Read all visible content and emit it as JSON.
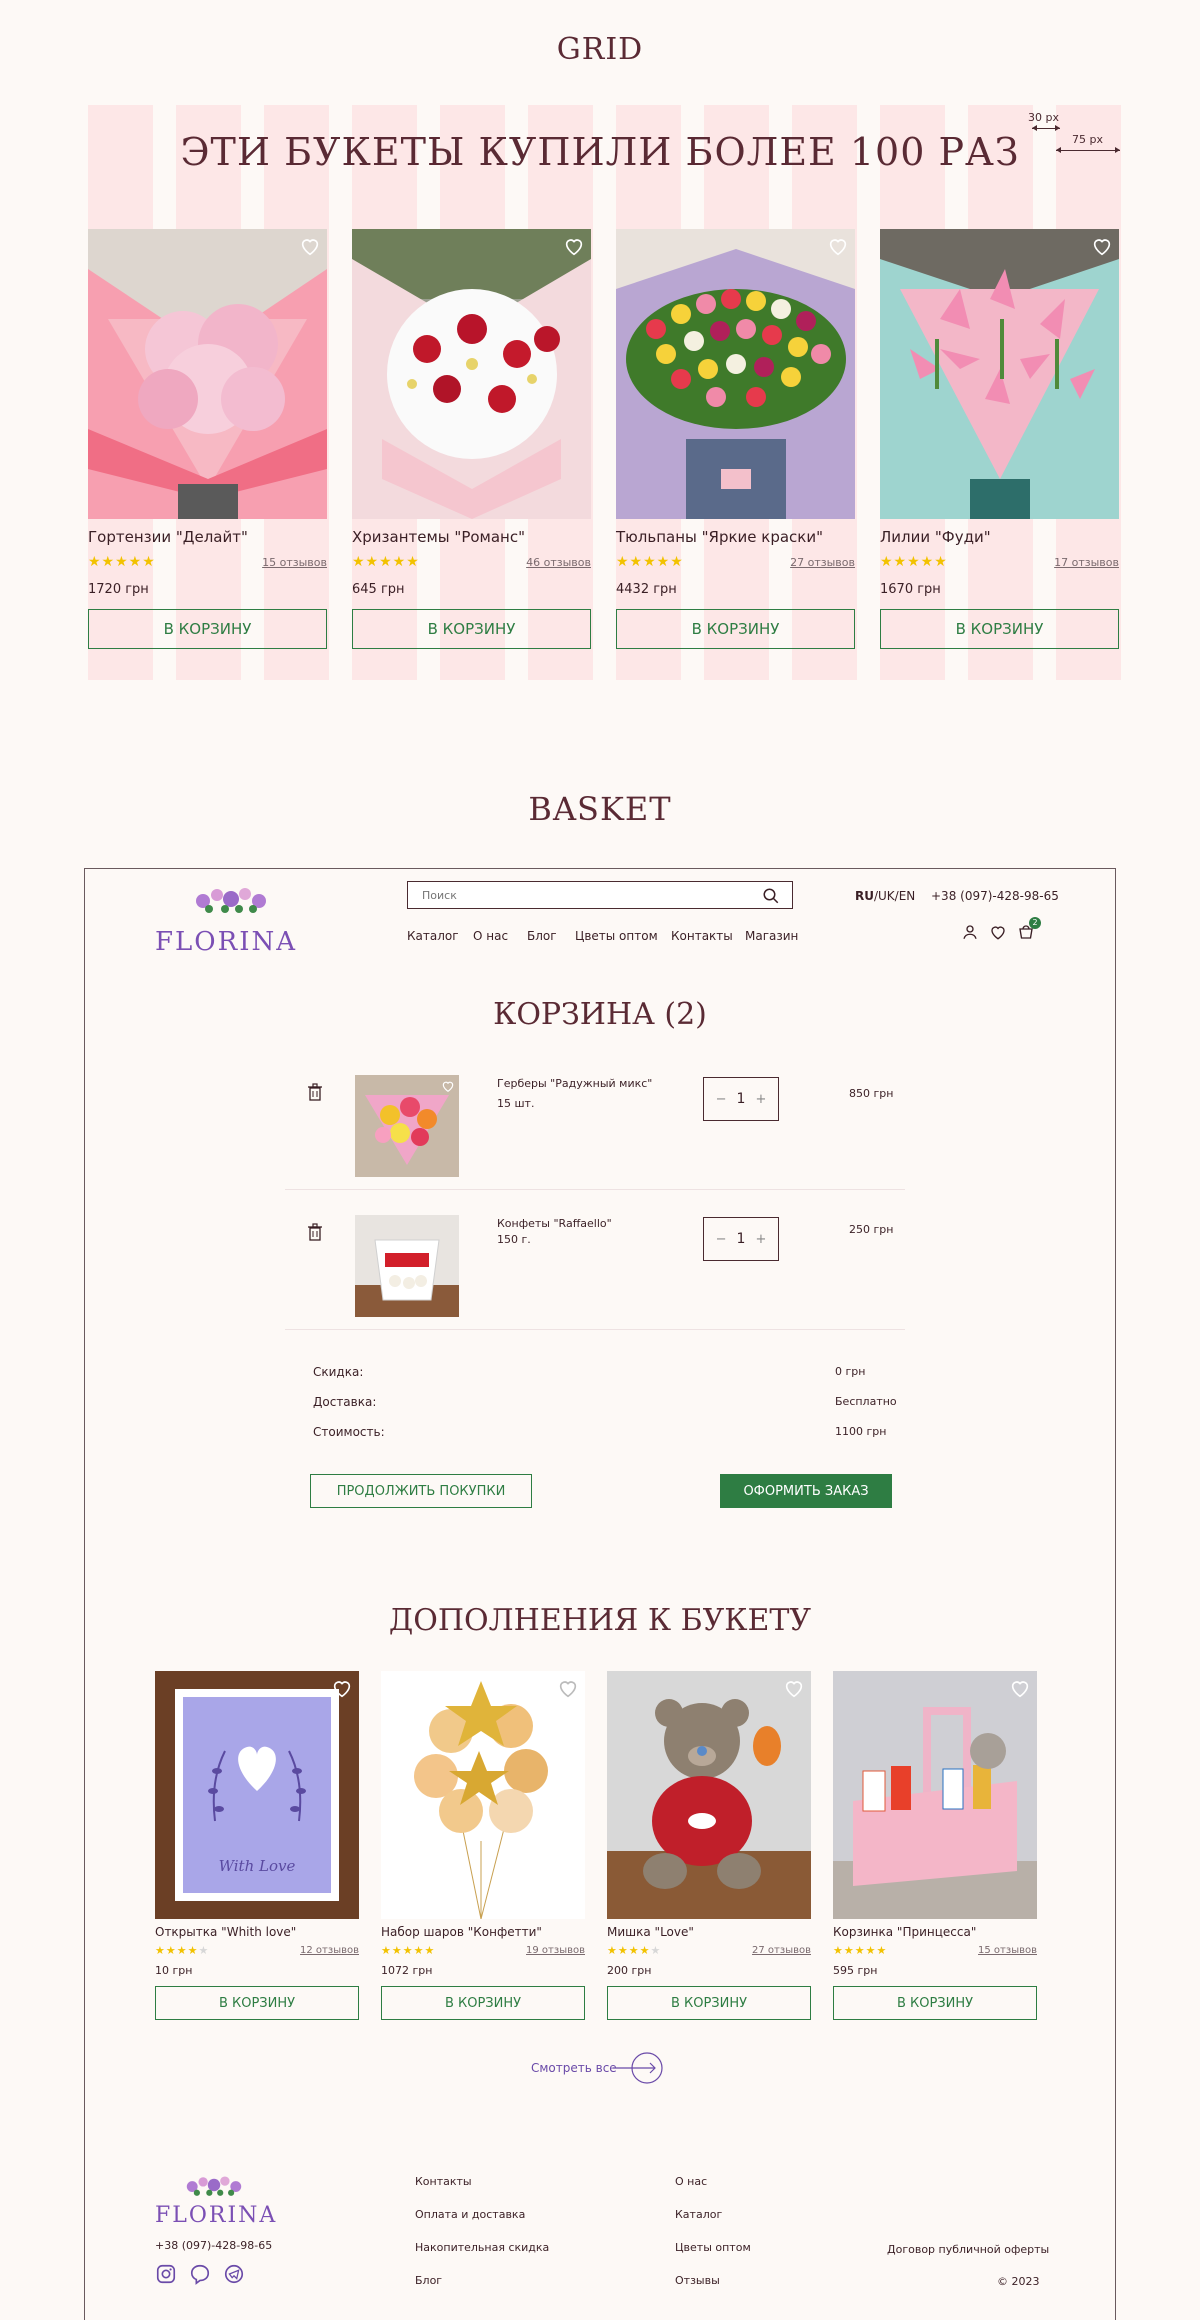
{
  "grid_section": {
    "label": "GRID",
    "annot_gutter": "30 px",
    "annot_column": "75 px",
    "heading": "ЭТИ БУКЕТЫ КУПИЛИ БОЛЕЕ 100 РАЗ",
    "products": [
      {
        "name": "Гортензии \"Делайт\"",
        "reviews": "15 отзывов",
        "price": "1720 грн",
        "rating": 5,
        "button": "В КОРЗИНУ"
      },
      {
        "name": "Хризантемы \"Романс\"",
        "reviews": "46 отзывов",
        "price": "645 грн",
        "rating": 5,
        "button": "В КОРЗИНУ"
      },
      {
        "name": "Тюльпаны \"Яркие краски\"",
        "reviews": "27 отзывов",
        "price": "4432 грн",
        "rating": 5,
        "button": "В КОРЗИНУ"
      },
      {
        "name": "Лилии \"Фуди\"",
        "reviews": "17 отзывов",
        "price": "1670 грн",
        "rating": 5,
        "button": "В КОРЗИНУ"
      }
    ]
  },
  "basket_section": {
    "label": "BASKET"
  },
  "header": {
    "logo": "FLORINA",
    "search_placeholder": "Поиск",
    "lang_active": "RU",
    "lang_rest": "/UK/EN",
    "phone": "+38 (097)-428-98-65",
    "cart_count": "2",
    "nav": [
      "Каталог",
      "О нас",
      "Блог",
      "Цветы оптом",
      "Контакты",
      "Магазин"
    ]
  },
  "basket": {
    "title": "КОРЗИНА (2)",
    "items": [
      {
        "name": "Герберы \"Радужный микс\"",
        "amount": "15 шт.",
        "qty": "1",
        "price": "850 грн"
      },
      {
        "name": "Конфеты \"Raffaello\"",
        "amount": "150 г.",
        "qty": "1",
        "price": "250 грн"
      }
    ],
    "summary": [
      {
        "label": "Скидка:",
        "value": "0 грн"
      },
      {
        "label": "Доставка:",
        "value": "Бесплатно"
      },
      {
        "label": "Стоимость:",
        "value": "1100 грн"
      }
    ],
    "continue_button": "ПРОДОЛЖИТЬ ПОКУПКИ",
    "order_button": "ОФОРМИТЬ ЗАКАЗ"
  },
  "addons": {
    "title": "ДОПОЛНЕНИЯ К БУКЕТУ",
    "products": [
      {
        "name": "Открытка \"Whith love\"",
        "reviews": "12 отзывов",
        "price": "10 грн",
        "rating": 4,
        "button": "В КОРЗИНУ",
        "card_text": "With Love"
      },
      {
        "name": "Набор шаров \"Конфетти\"",
        "reviews": "19 отзывов",
        "price": "1072 грн",
        "rating": 5,
        "button": "В КОРЗИНУ"
      },
      {
        "name": "Мишка \"Love\"",
        "reviews": "27 отзывов",
        "price": "200 грн",
        "rating": 4,
        "button": "В КОРЗИНУ"
      },
      {
        "name": "Корзинка \"Принцесса\"",
        "reviews": "15 отзывов",
        "price": "595 грн",
        "rating": 5,
        "button": "В КОРЗИНУ"
      }
    ],
    "see_all": "Смотреть все"
  },
  "footer": {
    "logo": "FLORINA",
    "phone": "+38 (097)-428-98-65",
    "col1": [
      "Контакты",
      "Оплата и доставка",
      "Накопительная скидка",
      "Блог"
    ],
    "col2": [
      "О нас",
      "Каталог",
      "Цветы оптом",
      "Отзывы"
    ],
    "offer": "Договор публичной оферты",
    "copyright": "© 2023"
  },
  "colors": {
    "accent_green": "#2e7d43",
    "brand_purple": "#7b4fb4",
    "title_maroon": "#5a2a34",
    "stripe_pink": "#fde7e7",
    "star_yellow": "#f2c200"
  }
}
